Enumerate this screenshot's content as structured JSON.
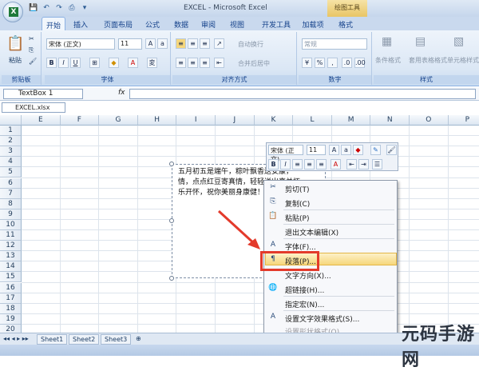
{
  "window": {
    "title": "EXCEL - Microsoft Excel",
    "tool_tab": "绘图工具"
  },
  "tabs": [
    "开始",
    "插入",
    "页面布局",
    "公式",
    "数据",
    "审阅",
    "视图",
    "开发工具",
    "加载项",
    "格式"
  ],
  "ribbon": {
    "clipboard": {
      "label": "剪贴板",
      "paste": "粘贴"
    },
    "font": {
      "label": "字体",
      "name": "宋体 (正文)",
      "size": "11"
    },
    "align": {
      "label": "对齐方式",
      "wrap": "自动换行",
      "merge": "合并后居中"
    },
    "number": {
      "label": "数字",
      "format": "常规"
    },
    "styles": {
      "label": "样式",
      "cond": "条件格式",
      "table": "套用表格格式",
      "cell": "单元格样式"
    }
  },
  "formula_bar": {
    "name_box": "TextBox 1",
    "fx": "fx",
    "content": ""
  },
  "document_tab": "EXCEL.xlsx",
  "columns": [
    "E",
    "F",
    "G",
    "H",
    "I",
    "J",
    "K",
    "L",
    "M",
    "N",
    "O",
    "P"
  ],
  "rows": [
    "1",
    "2",
    "3",
    "4",
    "5",
    "6",
    "7",
    "8",
    "9",
    "10",
    "11",
    "12",
    "13",
    "14",
    "15",
    "16",
    "17",
    "18",
    "19",
    "20"
  ],
  "textbox": {
    "lines": [
      "五月初五是端午，粽叶飘香送安康，",
      "情，点点红豆寄真情，轻轻送出真关怀，",
      "乐开怀，祝你美丽身康健！"
    ]
  },
  "minitoolbar": {
    "font": "宋体 (正文)",
    "size": "11"
  },
  "context_menu": {
    "items": [
      {
        "label": "剪切(T)",
        "icon": "scissors-icon",
        "glyph": "✂",
        "disabled": false
      },
      {
        "label": "复制(C)",
        "icon": "copy-icon",
        "glyph": "⎘",
        "disabled": false
      },
      {
        "label": "粘贴(P)",
        "icon": "paste-icon",
        "glyph": "📋",
        "disabled": false
      },
      {
        "label": "退出文本编辑(X)",
        "icon": "",
        "glyph": "",
        "disabled": false
      },
      {
        "label": "字体(F)...",
        "icon": "font-icon",
        "glyph": "A",
        "disabled": false
      },
      {
        "label": "段落(P)...",
        "icon": "paragraph-icon",
        "glyph": "¶",
        "disabled": false
      },
      {
        "label": "文字方向(X)...",
        "icon": "",
        "glyph": "",
        "disabled": false
      },
      {
        "label": "超链接(H)...",
        "icon": "hyperlink-icon",
        "glyph": "🌐",
        "disabled": false
      },
      {
        "label": "指定宏(N)...",
        "icon": "",
        "glyph": "",
        "disabled": false
      },
      {
        "label": "设置文字效果格式(S)...",
        "icon": "text-effect-icon",
        "glyph": "A",
        "disabled": false
      },
      {
        "label": "设置形状格式(O)...",
        "icon": "shape-format-icon",
        "glyph": "",
        "disabled": true
      }
    ]
  },
  "sheets": [
    "Sheet1",
    "Sheet2",
    "Sheet3"
  ],
  "watermark": "元码手游网"
}
